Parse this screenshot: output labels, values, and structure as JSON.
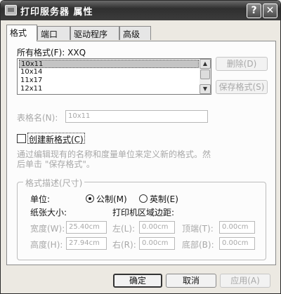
{
  "window": {
    "title": "打印服务器 属性"
  },
  "titlebar_buttons": {
    "help": "?",
    "close": "✕"
  },
  "tabs": [
    {
      "label": "格式",
      "active": true
    },
    {
      "label": "端口",
      "active": false
    },
    {
      "label": "驱动程序",
      "active": false
    },
    {
      "label": "高级",
      "active": false
    }
  ],
  "forms": {
    "all_forms_label": "所有格式(F): XXQ",
    "items": [
      "10x11",
      "10x14",
      "11x17",
      "12x11"
    ],
    "selected_index": 0,
    "delete_button": "删除(D)",
    "save_button": "保存格式(S)"
  },
  "form_name": {
    "label": "表格名(N):",
    "value": "10x11"
  },
  "create_new": {
    "label": "创建新格式(C)",
    "checked": false
  },
  "description_text": {
    "line1": "通过编辑现有的名称和度量单位来定义新的格式。然",
    "line2": "后单击 \"保存格式\"。"
  },
  "format_desc": {
    "title": "格式描述(尺寸)",
    "unit_label": "单位:",
    "unit_metric": "公制(M)",
    "unit_english": "英制(E)",
    "unit_selected": "metric",
    "paper_size_label": "纸张大小:",
    "margin_label": "打印机区域边距:",
    "width_label": "宽度(W):",
    "width_value": "25.40cm",
    "height_label": "高度(H):",
    "height_value": "27.94cm",
    "left_label": "左(L):",
    "left_value": "0.00cm",
    "right_label": "右(R):",
    "right_value": "0.00cm",
    "top_label": "顶端(T):",
    "top_value": "0.00cm",
    "bottom_label": "底部(B):",
    "bottom_value": "0.00cm"
  },
  "buttons": {
    "ok": "确定",
    "cancel": "取消",
    "apply": "应用(A)"
  }
}
